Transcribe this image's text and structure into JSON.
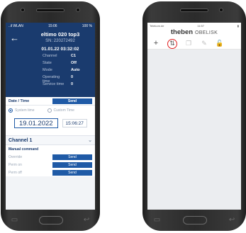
{
  "android": {
    "status": {
      "left": "..il WLAN",
      "time": "15:06",
      "right": "100 %"
    },
    "device": {
      "name": "eltimo 020 top3",
      "serial": "SN: 220272492",
      "datetime": "01.01.22 03:32:02",
      "fields": [
        {
          "key": "Channel",
          "value": "C1"
        },
        {
          "key": "State",
          "value": "Off"
        },
        {
          "key": "Mode",
          "value": "Auto"
        },
        {
          "key": "Operating time",
          "value": "0"
        },
        {
          "key": "Service time",
          "value": "0"
        }
      ]
    },
    "date_time": {
      "title": "Date / Time",
      "send": "Send",
      "system_time": "System time",
      "custom_time": "Custom Time",
      "date": "19.01.2022",
      "time": "15:06:27"
    },
    "channel": {
      "title": "Channel 1"
    },
    "manual": {
      "title": "Manual command",
      "rows": [
        {
          "label": "Override",
          "button": "Send"
        },
        {
          "label": "Perm on",
          "button": "Send"
        },
        {
          "label": "Perm off",
          "button": "Send"
        }
      ]
    }
  },
  "iphone": {
    "status": {
      "left": "Telekom.de",
      "time": "11:57"
    },
    "brand": {
      "logo": "theben",
      "product": "OBELISK"
    }
  },
  "icons": {
    "back": "back-arrow-icon",
    "chevron": "chevron-down-icon",
    "add": "plus-icon",
    "upload": "transfer-icon",
    "copy": "copy-icon",
    "edit": "pencil-icon",
    "lock": "lock-icon"
  }
}
